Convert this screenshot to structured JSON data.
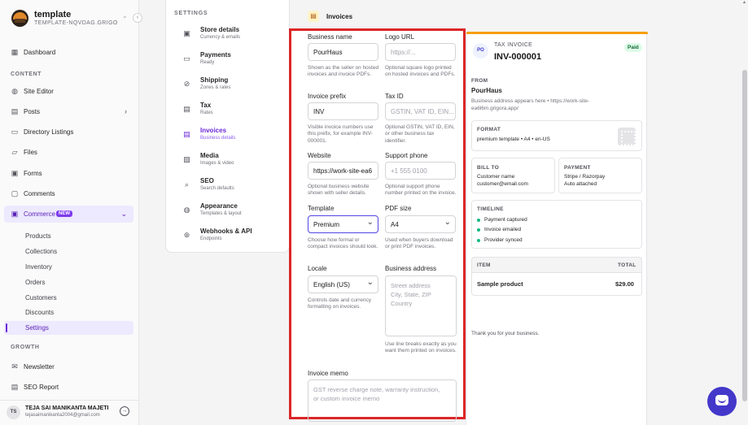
{
  "workspace": {
    "name": "template",
    "subtitle": "TEMPLATE-NQVDAG.GRIGOR..."
  },
  "sidebar": {
    "dashboard": "Dashboard",
    "content_label": "CONTENT",
    "site_editor": "Site Editor",
    "posts": "Posts",
    "directory": "Directory Listings",
    "files": "Files",
    "forms": "Forms",
    "comments": "Comments",
    "commerce": "Commerce",
    "commerce_badge": "NEW",
    "commerce_sub": [
      "Products",
      "Collections",
      "Inventory",
      "Orders",
      "Customers",
      "Discounts",
      "Settings"
    ],
    "growth_label": "GROWTH",
    "newsletter": "Newsletter",
    "seo_report": "SEO Report"
  },
  "user": {
    "initials": "TS",
    "name": "TEJA SAI MANIKANTA MAJETI",
    "email": "tejasaimanikanta2004@gmail.com"
  },
  "settings_menu": {
    "title": "SETTINGS",
    "items": [
      {
        "title": "Store details",
        "desc": "Currency & emails",
        "icon": "store-icon"
      },
      {
        "title": "Payments",
        "desc": "Ready",
        "icon": "card-icon"
      },
      {
        "title": "Shipping",
        "desc": "Zones & rates",
        "icon": "truck-icon"
      },
      {
        "title": "Tax",
        "desc": "Rates",
        "icon": "receipt-icon"
      },
      {
        "title": "Invoices",
        "desc": "Business details",
        "icon": "invoice-icon"
      },
      {
        "title": "Media",
        "desc": "Images & video",
        "icon": "image-icon"
      },
      {
        "title": "SEO",
        "desc": "Search defaults",
        "icon": "search-icon"
      },
      {
        "title": "Appearance",
        "desc": "Templates & layout",
        "icon": "palette-icon"
      },
      {
        "title": "Webhooks & API",
        "desc": "Endpoints",
        "icon": "webhook-icon"
      }
    ]
  },
  "page": {
    "title": "Invoices"
  },
  "form": {
    "business_name": {
      "label": "Business name",
      "value": "PourHaus",
      "help": "Shown as the seller on hosted invoices and invoice PDFs."
    },
    "logo_url": {
      "label": "Logo URL",
      "placeholder": "https://...",
      "help": "Optional square logo printed on hosted invoices and PDFs."
    },
    "invoice_prefix": {
      "label": "Invoice prefix",
      "value": "INV",
      "help": "Visible invoice numbers use this prefix, for example INV-000001."
    },
    "tax_id": {
      "label": "Tax ID",
      "placeholder": "GSTIN, VAT ID, EIN...",
      "help": "Optional GSTIN, VAT ID, EIN, or other business tax identifier."
    },
    "website": {
      "label": "Website",
      "value": "https://work-site-ea6",
      "help": "Optional business website shown with seller details."
    },
    "support_phone": {
      "label": "Support phone",
      "placeholder": "+1 555 0100",
      "help": "Optional support phone number printed on the invoice."
    },
    "template": {
      "label": "Template",
      "value": "Premium",
      "help": "Choose how formal or compact invoices should look."
    },
    "pdf_size": {
      "label": "PDF size",
      "value": "A4",
      "help": "Used when buyers download or print PDF invoices."
    },
    "locale": {
      "label": "Locale",
      "value": "English (US)",
      "help": "Controls date and currency formatting on invoices."
    },
    "business_address": {
      "label": "Business address",
      "placeholder_lines": [
        "Street address",
        "City, State, ZIP",
        "Country"
      ],
      "help": "Use line breaks exactly as you want them printed on invoices."
    },
    "invoice_memo": {
      "label": "Invoice memo",
      "placeholder_lines": [
        "GST reverse charge note, warranty instruction,",
        "or custom invoice memo"
      ]
    }
  },
  "preview": {
    "initials": "PO",
    "doc_type": "TAX INVOICE",
    "number": "INV-000001",
    "status": "Paid",
    "from_label": "FROM",
    "from_name": "PourHaus",
    "from_note": [
      "Business address appears here • https://work-site-",
      "ea6l6m.grigora.app/"
    ],
    "format_label": "FORMAT",
    "format_value": "premium template • A4 • en-US",
    "bill_to_label": "BILL TO",
    "bill_to_name": "Customer name",
    "bill_to_email": "customer@email.com",
    "payment_label": "PAYMENT",
    "payment_provider": "Stripe / Razorpay",
    "payment_note": "Auto attached",
    "timeline_label": "TIMELINE",
    "timeline": [
      "Payment captured",
      "Invoice emailed",
      "Provider synced"
    ],
    "item_header": "ITEM",
    "total_header": "TOTAL",
    "item_name": "Sample product",
    "item_total": "$29.00",
    "footer": "Thank you for your business."
  },
  "colors": {
    "accent": "#6d28d9",
    "highlight": "#dc2626",
    "paid": "#166534",
    "banner": "#f59e0b"
  }
}
